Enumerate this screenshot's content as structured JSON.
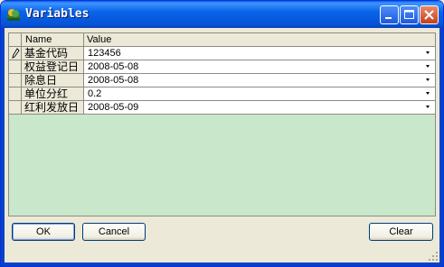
{
  "window": {
    "title": "Variables"
  },
  "grid": {
    "headers": {
      "name": "Name",
      "value": "Value"
    },
    "rows": [
      {
        "name": "基金代码",
        "value": "123456"
      },
      {
        "name": "权益登记日",
        "value": "2008-05-08"
      },
      {
        "name": "除息日",
        "value": "2008-05-08"
      },
      {
        "name": "单位分红",
        "value": "0.2"
      },
      {
        "name": "红利发放日",
        "value": "2008-05-09"
      }
    ]
  },
  "buttons": {
    "ok": "OK",
    "cancel": "Cancel",
    "clear": "Clear"
  },
  "colors": {
    "grid_background": "#c9e7cb",
    "titlebar": "#0a5ee8"
  },
  "icons": {
    "app": "variables-app-icon",
    "row_edit": "pencil-icon",
    "dropdown": "dropdown-arrow-icon"
  }
}
